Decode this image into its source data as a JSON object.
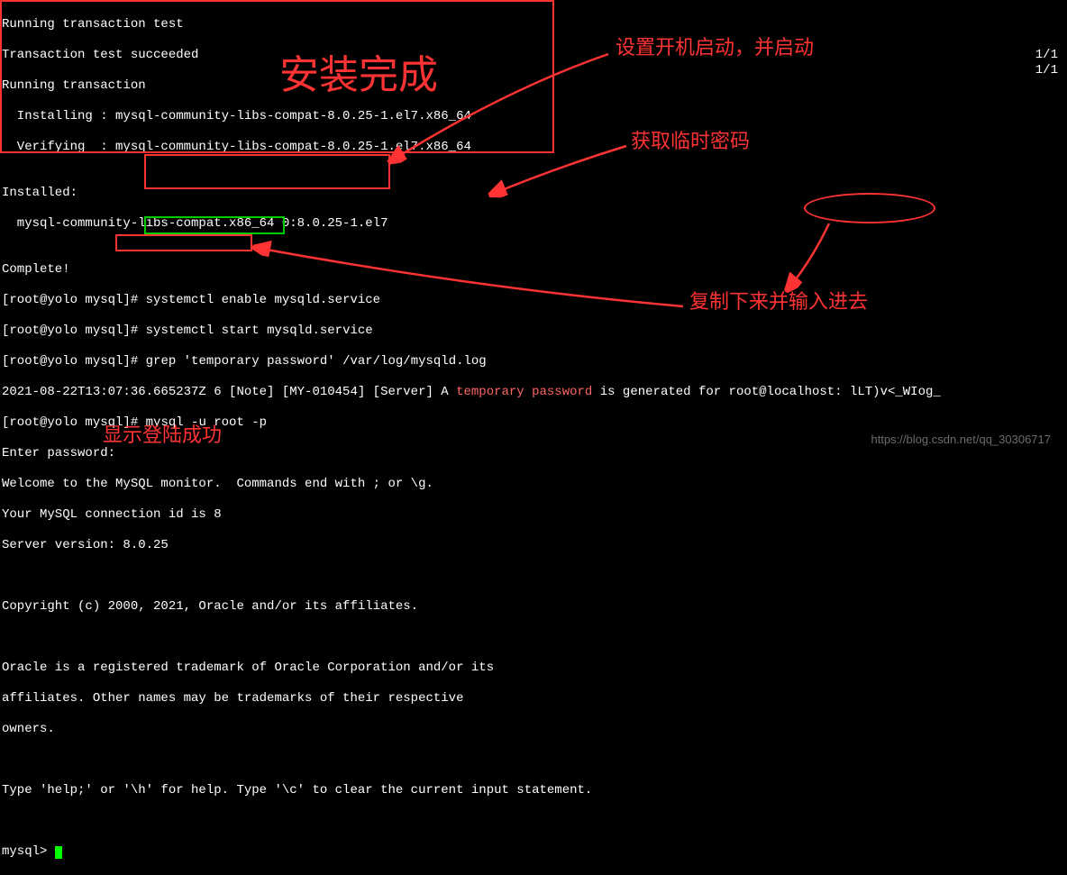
{
  "terminal": {
    "l1": "Running transaction test",
    "l2": "Transaction test succeeded",
    "l3": "Running transaction",
    "l4": "  Installing : mysql-community-libs-compat-8.0.25-1.el7.x86_64",
    "l5": "  Verifying  : mysql-community-libs-compat-8.0.25-1.el7.x86_64",
    "l6": "",
    "l7": "Installed:",
    "l8": "  mysql-community-libs-compat.x86_64 0:8.0.25-1.el7",
    "l9": "",
    "l10": "Complete!",
    "prompt": "[root@yolo mysql]# ",
    "cmd1": "systemctl enable mysqld.service",
    "cmd2": "systemctl start mysqld.service",
    "cmd3": "grep 'temporary password' /var/log/mysqld.log",
    "log_prefix": "2021-08-22T13:07:36.665237Z 6 [Note] [MY-010454] [Server] A ",
    "log_highlight": "temporary password",
    "log_suffix": " is generated for root@localhost: lLT)v<_WIog_",
    "cmd4": "mysql -u root -p",
    "enter_pwd": "Enter password:",
    "welcome1": "Welcome to the MySQL monitor.  Commands end with ; or \\g.",
    "welcome2": "Your MySQL connection id is 8",
    "welcome3": "Server version: 8.0.25",
    "copyright": "Copyright (c) 2000, 2021, Oracle and/or its affiliates.",
    "trademark1": "Oracle is a registered trademark of Oracle Corporation and/or its",
    "trademark2": "affiliates. Other names may be trademarks of their respective",
    "trademark3": "owners.",
    "help_line": "Type 'help;' or '\\h' for help. Type '\\c' to clear the current input statement.",
    "mysql_prompt": "mysql> ",
    "line_count": "1/1"
  },
  "annotations": {
    "install_complete": "安装完成",
    "set_boot": "设置开机启动，并启动",
    "get_temp_pwd": "获取临时密码",
    "copy_input": "复制下来并输入进去",
    "login_success": "显示登陆成功"
  },
  "watermark": "https://blog.csdn.net/qq_30306717"
}
